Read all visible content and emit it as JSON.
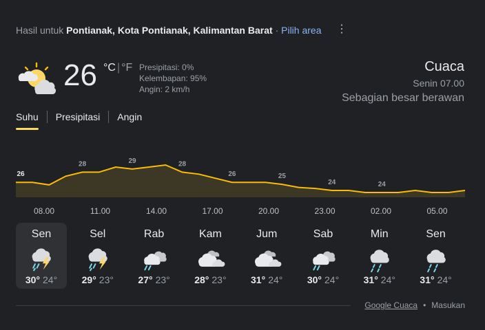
{
  "header": {
    "prefix": "Hasil untuk",
    "location": "Pontianak, Kota Pontianak, Kalimantan Barat",
    "separator": "·",
    "pick_area": "Pilih area",
    "more_icon": "more-vert-icon"
  },
  "current": {
    "icon": "partly-cloudy-sun-icon",
    "temperature": "26",
    "unit_c": "°C",
    "unit_sep": "|",
    "unit_f": "°F",
    "precip": "Presipitasi: 0%",
    "humidity": "Kelembapan: 95%",
    "wind": "Angin: 2 km/h",
    "title": "Cuaca",
    "time": "Senin 07.00",
    "condition": "Sebagian besar berawan"
  },
  "tabs": [
    {
      "label": "Suhu",
      "active": true
    },
    {
      "label": "Presipitasi",
      "active": false
    },
    {
      "label": "Angin",
      "active": false
    }
  ],
  "chart_data": {
    "type": "area",
    "series": [
      {
        "values": [
          26,
          26,
          25.5,
          27.2,
          28,
          28,
          29,
          28.6,
          29,
          29.4,
          28,
          27.6,
          26.8,
          26,
          26,
          26,
          25.6,
          25,
          24.8,
          24.4,
          24.4,
          24,
          24,
          24,
          24.4,
          24,
          24,
          24.4
        ]
      }
    ],
    "labels": [
      {
        "index": 0,
        "text": "26"
      },
      {
        "index": 4,
        "text": "28"
      },
      {
        "index": 7,
        "text": "29"
      },
      {
        "index": 10,
        "text": "28"
      },
      {
        "index": 13,
        "text": "26"
      },
      {
        "index": 16,
        "text": "25"
      },
      {
        "index": 19,
        "text": "24"
      },
      {
        "index": 22,
        "text": "24"
      }
    ],
    "x_ticks": [
      "08.00",
      "11.00",
      "14.00",
      "17.00",
      "20.00",
      "23.00",
      "02.00",
      "05.00"
    ],
    "colors": {
      "line": "#fbbc04",
      "fill": "#3d3826",
      "label": "#9aa0a6",
      "first_label": "#e8eaed"
    }
  },
  "days": [
    {
      "name": "Sen",
      "icon": "thunderstorm-icon",
      "hi": "30°",
      "lo": "24°",
      "selected": true
    },
    {
      "name": "Sel",
      "icon": "thunderstorm-icon",
      "hi": "29°",
      "lo": "23°",
      "selected": false
    },
    {
      "name": "Rab",
      "icon": "sun-showers-icon",
      "hi": "27°",
      "lo": "23°",
      "selected": false
    },
    {
      "name": "Kam",
      "icon": "cloudy-icon",
      "hi": "28°",
      "lo": "23°",
      "selected": false
    },
    {
      "name": "Jum",
      "icon": "cloudy-icon",
      "hi": "31°",
      "lo": "24°",
      "selected": false
    },
    {
      "name": "Sab",
      "icon": "sun-showers-icon",
      "hi": "30°",
      "lo": "24°",
      "selected": false
    },
    {
      "name": "Min",
      "icon": "rain-icon",
      "hi": "31°",
      "lo": "24°",
      "selected": false
    },
    {
      "name": "Sen",
      "icon": "rain-icon",
      "hi": "31°",
      "lo": "24°",
      "selected": false
    }
  ],
  "footer": {
    "source": "Google Cuaca",
    "dot": "•",
    "feedback": "Masukan"
  }
}
